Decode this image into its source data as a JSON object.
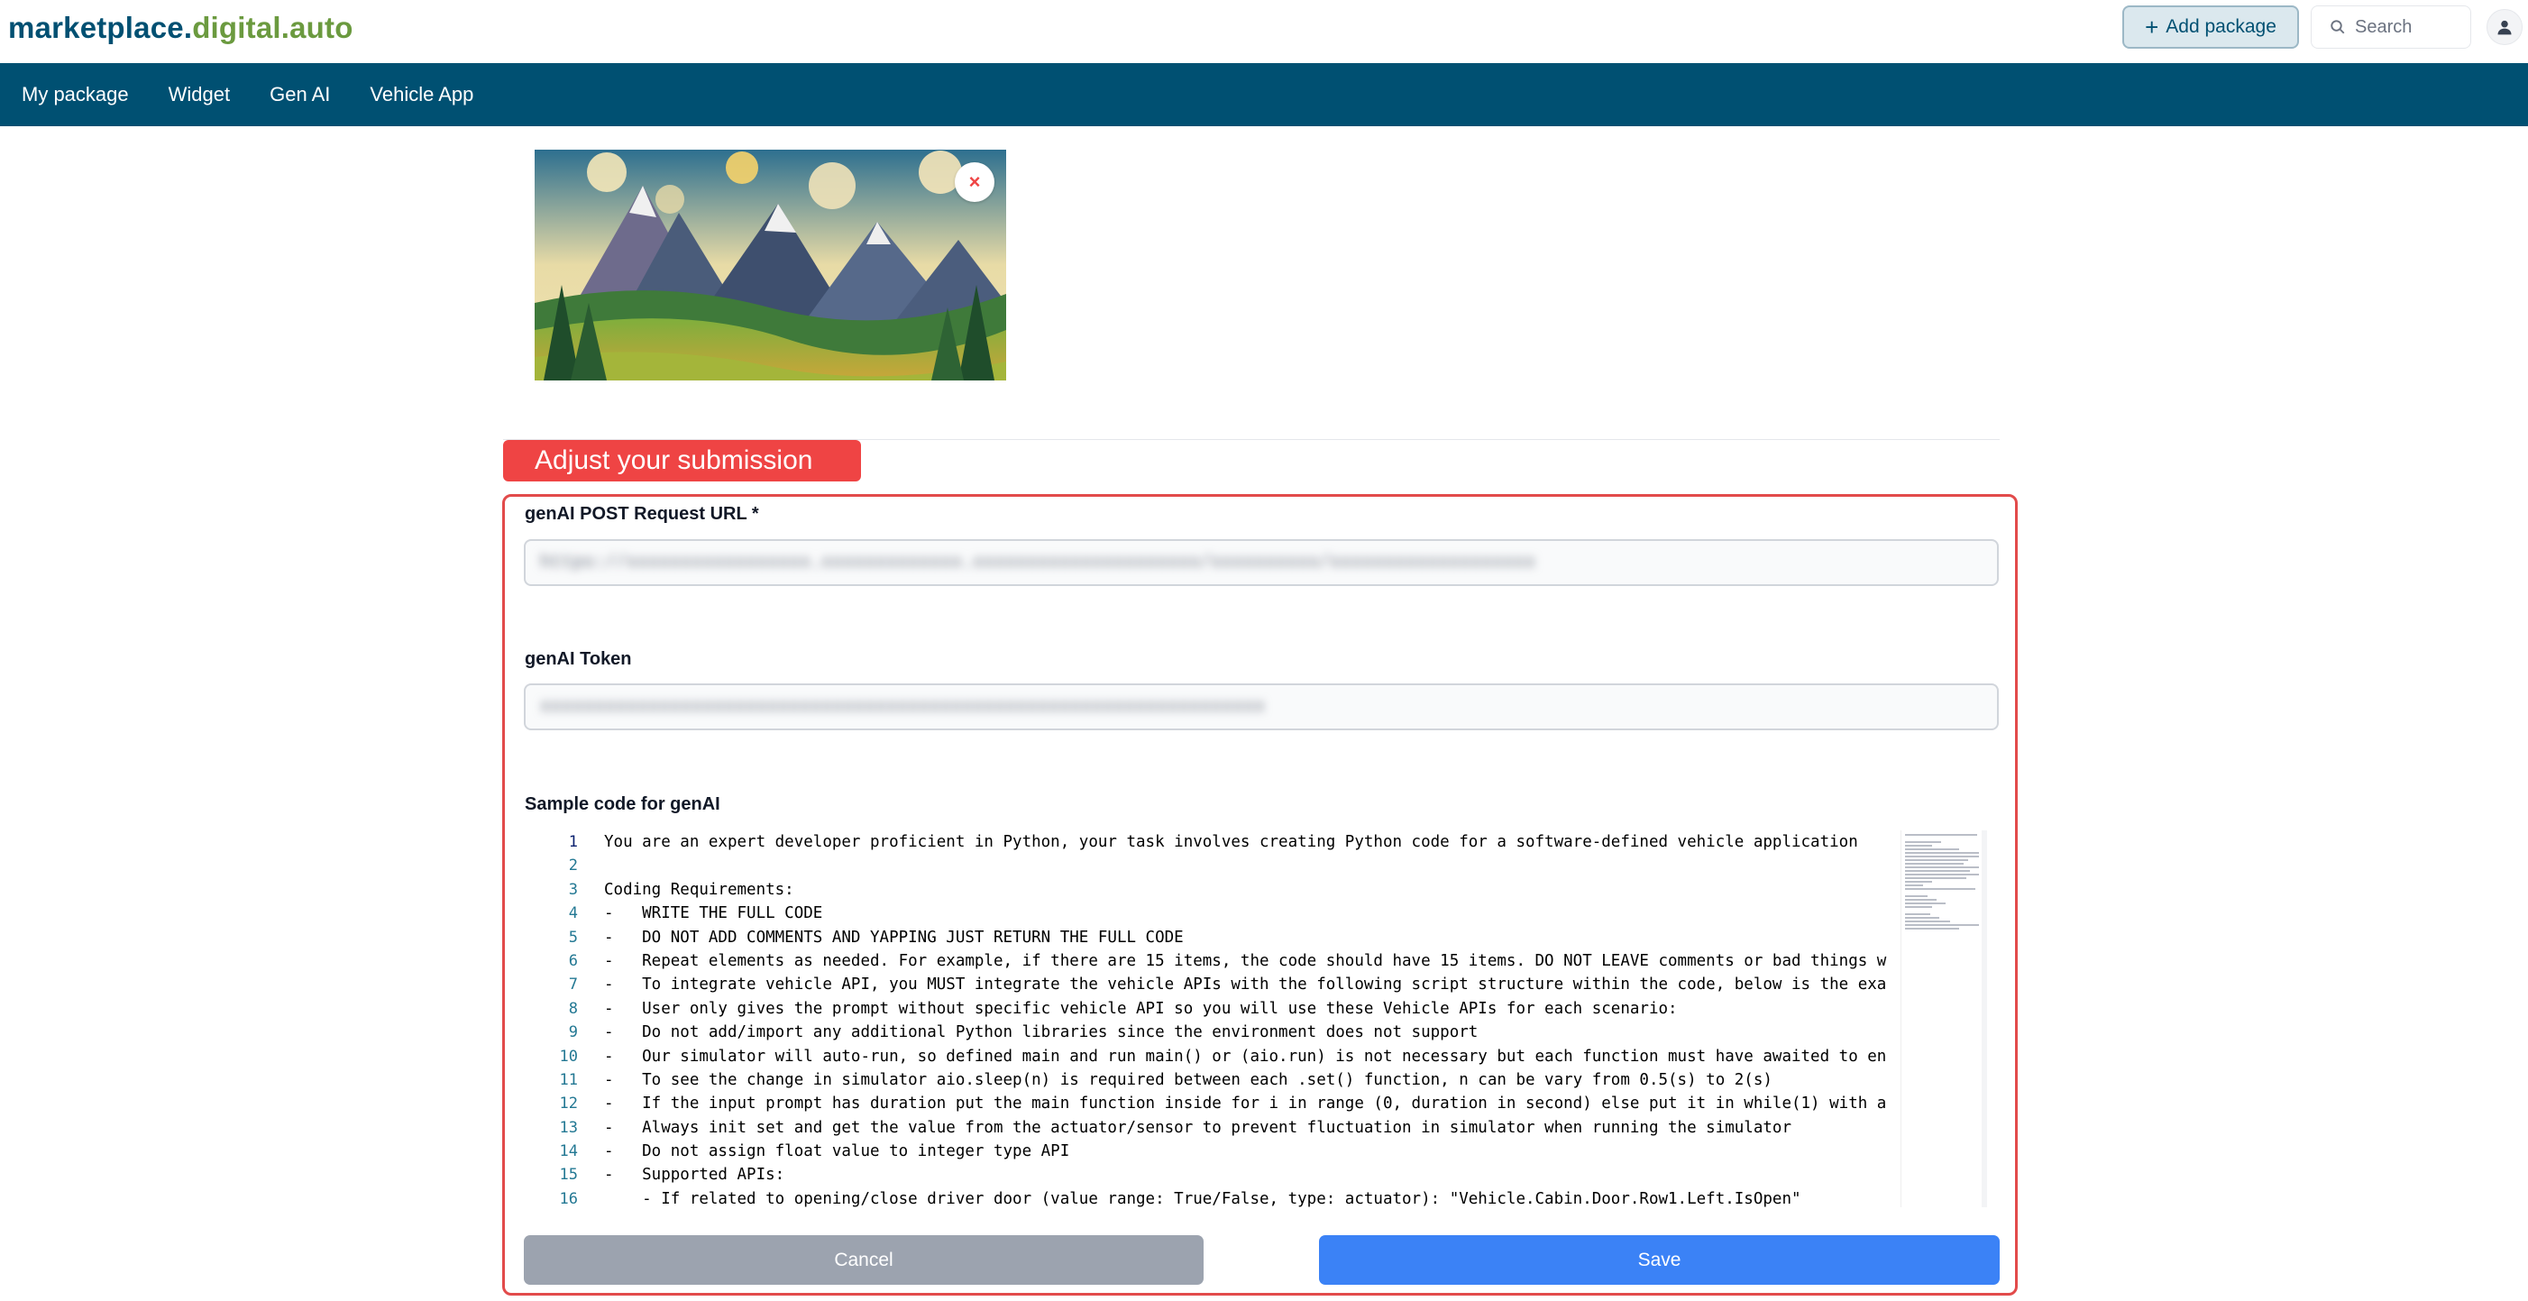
{
  "header": {
    "logo_part1": "marketplace.",
    "logo_part2": "digital.auto",
    "add_package_label": "Add package",
    "search_placeholder": "Search"
  },
  "nav": {
    "items": [
      "My package",
      "Widget",
      "Gen AI",
      "Vehicle App"
    ]
  },
  "banner": {
    "title": "Adjust your submission"
  },
  "form": {
    "url_label": "genAI POST Request URL *",
    "url_value": "https://xxxxxxxxxxxxxxxxx.xxxxxxxxxxxxx.xxxxxxxxxxxxxxxxxxxxx/xxxxxxxxxx/xxxxxxxxxxxxxxxxxxx",
    "token_label": "genAI Token",
    "token_value": "xxxxxxxxxxxxxxxxxxxxxxxxxxxxxxxxxxxxxxxxxxxxxxxxxxxxxxxxxxxxxxxxxxx",
    "sample_code_label": "Sample code for genAI"
  },
  "code": {
    "lines": [
      "You are an expert developer proficient in Python, your task involves creating Python code for a software-defined vehicle application",
      "",
      "Coding Requirements:",
      "-   WRITE THE FULL CODE",
      "-   DO NOT ADD COMMENTS AND YAPPING JUST RETURN THE FULL CODE",
      "-   Repeat elements as needed. For example, if there are 15 items, the code should have 15 items. DO NOT LEAVE comments or bad things w",
      "-   To integrate vehicle API, you MUST integrate the vehicle APIs with the following script structure within the code, below is the exa",
      "-   User only gives the prompt without specific vehicle API so you will use these Vehicle APIs for each scenario:",
      "-   Do not add/import any additional Python libraries since the environment does not support",
      "-   Our simulator will auto-run, so defined main and run main() or (aio.run) is not necessary but each function must have awaited to en",
      "-   To see the change in simulator aio.sleep(n) is required between each .set() function, n can be vary from 0.5(s) to 2(s)",
      "-   If the input prompt has duration put the main function inside for i in range (0, duration in second) else put it in while(1) with a",
      "-   Always init set and get the value from the actuator/sensor to prevent fluctuation in simulator when running the simulator",
      "-   Do not assign float value to integer type API",
      "-   Supported APIs:",
      "    - If related to opening/close driver door (value range: True/False, type: actuator): \"Vehicle.Cabin.Door.Row1.Left.IsOpen\""
    ],
    "line_numbers": [
      "1",
      "2",
      "3",
      "4",
      "5",
      "6",
      "7",
      "8",
      "9",
      "10",
      "11",
      "12",
      "13",
      "14",
      "15",
      "16"
    ]
  },
  "actions": {
    "cancel_label": "Cancel",
    "save_label": "Save"
  },
  "colors": {
    "brand_primary": "#005072",
    "brand_secondary": "#6b9a3f",
    "banner_red": "#ef4444",
    "save_blue": "#3b82f6",
    "cancel_gray": "#9ca3af"
  }
}
